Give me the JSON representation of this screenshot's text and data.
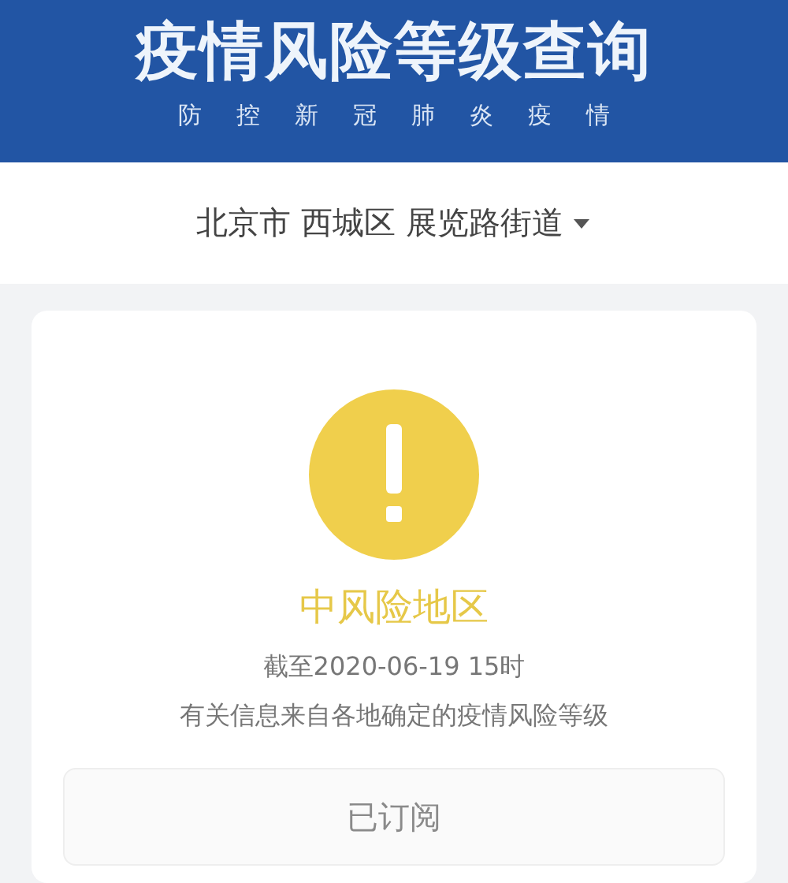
{
  "header": {
    "title": "疫情风险等级查询",
    "subtitle": "防控新冠肺炎疫情"
  },
  "location": {
    "parts": [
      "北京市",
      "西城区",
      "展览路街道"
    ],
    "expanded": false
  },
  "result": {
    "kind": "medium",
    "label": "中风险地区",
    "as_of": "截至2020-06-19 15时",
    "note": "有关信息来自各地确定的疫情风险等级"
  },
  "subscribe": {
    "label": "已订阅",
    "subscribed": true
  }
}
